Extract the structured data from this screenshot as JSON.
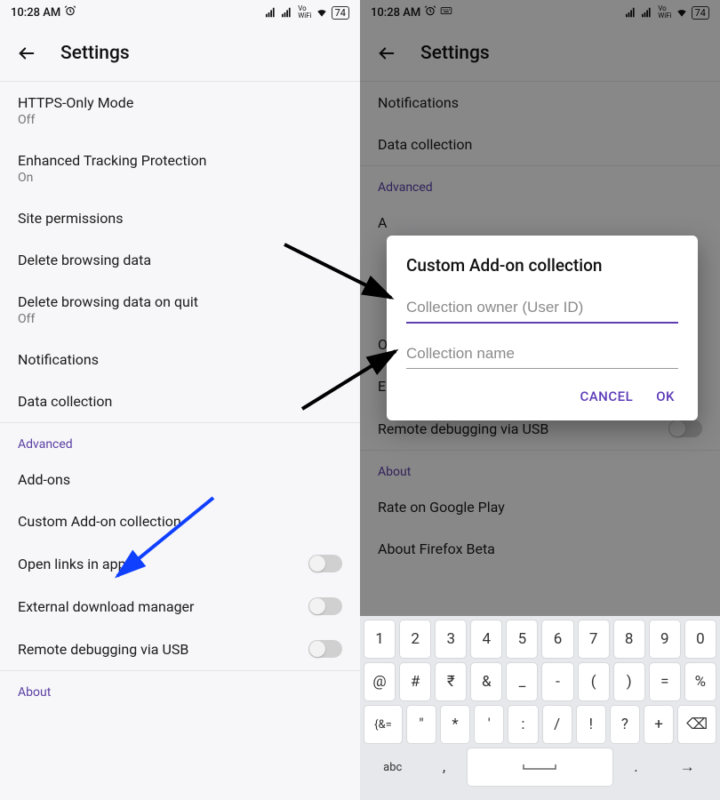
{
  "status": {
    "time": "10:28 AM",
    "battery": "74",
    "vowifi": "Vo\nWiFi"
  },
  "appbar": {
    "title": "Settings"
  },
  "left_list": {
    "https": {
      "title": "HTTPS-Only Mode",
      "sub": "Off"
    },
    "etp": {
      "title": "Enhanced Tracking Protection",
      "sub": "On"
    },
    "siteperm": {
      "title": "Site permissions"
    },
    "delete": {
      "title": "Delete browsing data"
    },
    "deletequit": {
      "title": "Delete browsing data on quit",
      "sub": "Off"
    },
    "notifications": {
      "title": "Notifications"
    },
    "datacollect": {
      "title": "Data collection"
    },
    "section_advanced": "Advanced",
    "addons": {
      "title": "Add-ons"
    },
    "customaddon": {
      "title": "Custom Add-on collection"
    },
    "openlinks": {
      "title": "Open links in apps"
    },
    "extdl": {
      "title": "External download manager"
    },
    "remotedbg": {
      "title": "Remote debugging via USB"
    },
    "section_about": "About"
  },
  "right_list": {
    "notifications": {
      "title": "Notifications"
    },
    "datacollect": {
      "title": "Data collection"
    },
    "section_advanced": "Advanced",
    "a_initial": "A",
    "o_initial": "O",
    "e_initial": "E",
    "remotedbg": {
      "title": "Remote debugging via USB"
    },
    "section_about": "About",
    "rate": {
      "title": "Rate on Google Play"
    },
    "about": {
      "title": "About Firefox Beta"
    }
  },
  "dialog": {
    "title": "Custom Add-on collection",
    "owner_placeholder": "Collection owner (User ID)",
    "name_placeholder": "Collection name",
    "cancel": "CANCEL",
    "ok": "OK"
  },
  "keyboard": {
    "row1": [
      "1",
      "2",
      "3",
      "4",
      "5",
      "6",
      "7",
      "8",
      "9",
      "0"
    ],
    "row2": [
      "@",
      "#",
      "₹",
      "&",
      "_",
      "-",
      "(",
      ")",
      "=",
      "%"
    ],
    "row3_lead": "{&=",
    "row3": [
      "\"",
      "*",
      "'",
      ":",
      "/",
      "!",
      "?",
      "+"
    ],
    "row3_back": "⌫",
    "row4_abc": "abc",
    "row4_comma": ",",
    "row4_space": "⎵",
    "row4_dot": ".",
    "row4_enter": "→"
  }
}
